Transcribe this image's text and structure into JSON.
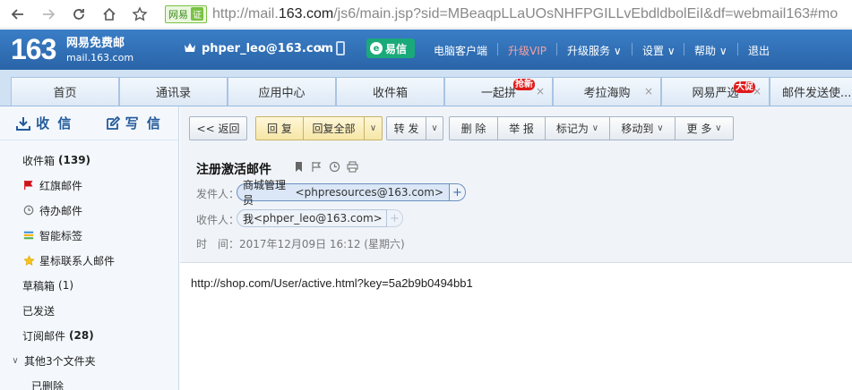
{
  "browser": {
    "site_badge": "网易",
    "site_badge_suffix": "证",
    "url_prefix": "http://mail.",
    "url_host": "163.com",
    "url_path": "/js6/main.jsp?sid=MBeaqpLLaUOsNHFPGILLvEbdldbolEiI&df=webmail163#mo"
  },
  "header": {
    "logo_number": "163",
    "logo_title": "网易免费邮",
    "logo_domain": "mail.163.com",
    "account": "phper_leo@163.com",
    "yixin": "易信",
    "nav": [
      "电脑客户端",
      "升级VIP",
      "升级服务",
      "设置",
      "帮助",
      "退出"
    ]
  },
  "tabs": [
    {
      "label": "首页",
      "closable": false
    },
    {
      "label": "通讯录",
      "closable": false
    },
    {
      "label": "应用中心",
      "closable": false
    },
    {
      "label": "收件箱",
      "closable": false
    },
    {
      "label": "一起拼",
      "badge": "抢新",
      "closable": true
    },
    {
      "label": "考拉海购",
      "closable": true
    },
    {
      "label": "网易严选",
      "badge": "大促",
      "closable": true
    },
    {
      "label": "邮件发送使...",
      "closable": true
    }
  ],
  "sidebar": {
    "receive_label": "收 信",
    "write_label": "写 信",
    "folders": [
      {
        "label": "收件箱",
        "count": "(139)",
        "icon": "none"
      },
      {
        "label": "红旗邮件",
        "count": "",
        "icon": "red-flag-icon"
      },
      {
        "label": "待办邮件",
        "count": "",
        "icon": "clock-icon"
      },
      {
        "label": "智能标签",
        "count": "",
        "icon": "tag-icon"
      },
      {
        "label": "星标联系人邮件",
        "count": "",
        "icon": "star-icon"
      },
      {
        "label": "草稿箱",
        "count": "(1)",
        "icon": "none"
      },
      {
        "label": "已发送",
        "count": "",
        "icon": "none"
      },
      {
        "label": "订阅邮件",
        "count": "(28)",
        "icon": "none"
      },
      {
        "label": "其他3个文件夹",
        "count": "",
        "icon": "chevron-down-icon"
      },
      {
        "label": "已删除",
        "count": "",
        "icon": "none"
      }
    ]
  },
  "toolbar": {
    "back": "<< 返回",
    "reply": "回 复",
    "reply_all": "回复全部",
    "forward": "转 发",
    "delete": "删 除",
    "report": "举 报",
    "mark_as": "标记为",
    "move_to": "移动到",
    "more": "更 多"
  },
  "message": {
    "subject": "注册激活邮件",
    "from_label": "发件人：",
    "from_name": "商城管理员",
    "from_addr": "<phpresources@163.com>",
    "to_label": "收件人：",
    "to_name": "我",
    "to_addr": "<phper_leo@163.com>",
    "time_label": "时　间：",
    "time_value": "2017年12月09日 16:12 (星期六)",
    "body": "http://shop.com/User/active.html?key=5a2b9b0494bb1"
  },
  "colors": {
    "header_blue": "#2d6cb5",
    "yixin_green": "#1aaa7a",
    "badge_red": "#e01b1b",
    "reply_yellow": "#f6e6a6"
  }
}
